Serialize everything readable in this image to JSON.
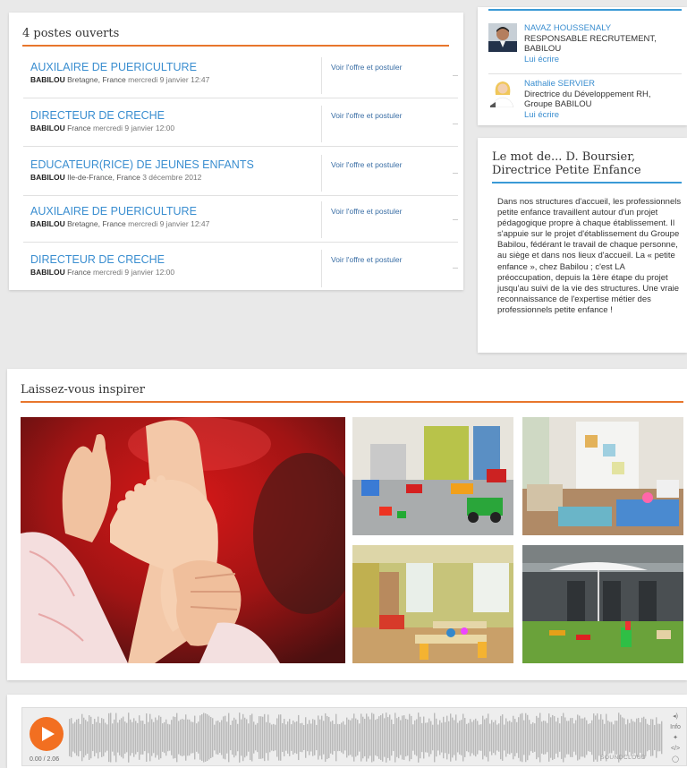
{
  "jobs": {
    "heading": "4 postes ouverts",
    "items": [
      {
        "title": "AUXILAIRE DE PUERICULTURE",
        "company": "BABILOU",
        "location": "Bretagne, France",
        "date": "mercredi 9 janvier 12:47",
        "action": "Voir l'offre et postuler"
      },
      {
        "title": "DIRECTEUR DE CRECHE",
        "company": "BABILOU",
        "location": "France",
        "date": "mercredi 9 janvier 12:00",
        "action": "Voir l'offre et postuler"
      },
      {
        "title": "EDUCATEUR(RICE) DE JEUNES ENFANTS",
        "company": "BABILOU",
        "location": "Ile-de-France, France",
        "date": "3 décembre 2012",
        "action": "Voir l'offre et postuler"
      },
      {
        "title": "AUXILAIRE DE PUERICULTURE",
        "company": "BABILOU",
        "location": "Bretagne, France",
        "date": "mercredi 9 janvier 12:47",
        "action": "Voir l'offre et postuler"
      },
      {
        "title": "DIRECTEUR DE CRECHE",
        "company": "BABILOU",
        "location": "France",
        "date": "mercredi 9 janvier 12:00",
        "action": "Voir l'offre et postuler"
      }
    ]
  },
  "contacts": [
    {
      "name": "NAVAZ HOUSSENALY",
      "role": "RESPONSABLE RECRUTEMENT, BABILOU",
      "action": "Lui écrire"
    },
    {
      "name": "Nathalie SERVIER",
      "role": "Directrice du Développement RH, Groupe BABILOU",
      "action": "Lui écrire"
    }
  ],
  "quote": {
    "title": "Le mot de... D. Boursier, Directrice Petite Enfance",
    "text": "Dans nos structures d'accueil, les professionnels petite enfance travaillent autour d'un projet pédagogique propre à chaque établissement. Il s'appuie sur le projet d'établissement du Groupe Babilou, fédérant le travail de chaque personne, au siège et dans nos lieux d'accueil. La « petite enfance », chez Babilou ; c'est LA préoccupation, depuis la 1ère étape du projet jusqu'au suivi de la vie des structures. Une vraie reconnaissance de l'expertise métier des professionnels petite enfance !"
  },
  "inspire": {
    "heading": "Laissez-vous inspirer"
  },
  "player": {
    "time": "0.00 / 2.06",
    "brand": "SOUNDCLOUD",
    "info_label": "Info"
  },
  "colors": {
    "accent_orange": "#e8762c",
    "accent_blue": "#3a9ad6",
    "link_blue": "#3a8ed0",
    "play_orange": "#f26f21"
  }
}
